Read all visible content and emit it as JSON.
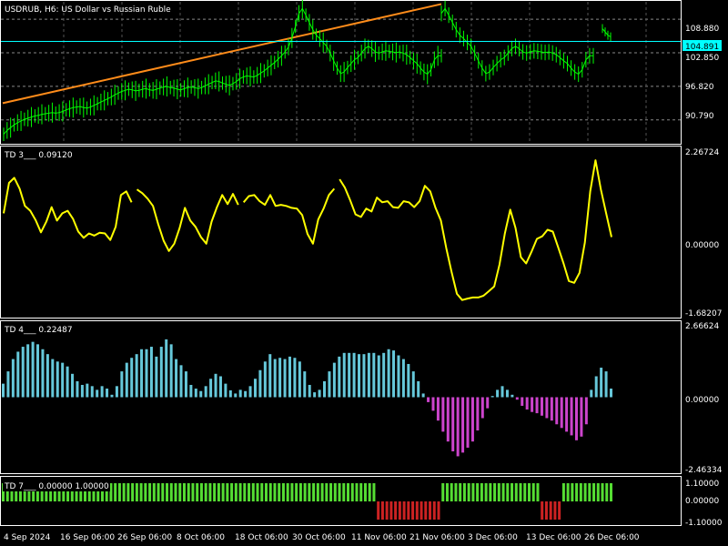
{
  "chart_data": [
    {
      "type": "line",
      "title": "USDRUB, H6:  US Dollar vs Russian Ruble",
      "yticks": [
        "108.880",
        "102.850",
        "96.820",
        "90.790"
      ],
      "ylim": [
        86.5,
        112.0
      ],
      "grid": true,
      "current_price": "104.891",
      "current_price_value": 104.891,
      "colors": {
        "up": "#00ff00",
        "price_line": "#00ffff",
        "trendline": "#ff8c1a",
        "price_box": "#00ffff"
      },
      "series": [
        {
          "values": [
            88.2,
            88.9,
            89.4,
            89.9,
            90.3,
            90.6,
            90.9,
            91.1,
            91.3,
            91.5,
            91.6,
            91.8,
            91.9,
            92.0,
            92.1,
            92.0,
            92.1,
            92.3,
            92.6,
            92.8,
            93.0,
            93.1,
            93.2,
            93.0,
            92.9,
            93.1,
            93.4,
            93.7,
            94.0,
            94.3,
            94.6,
            94.9,
            95.3,
            95.6,
            95.9,
            96.1,
            96.3,
            96.2,
            96.0,
            96.1,
            96.3,
            96.4,
            96.2,
            96.1,
            96.3,
            96.5,
            96.7,
            96.8,
            96.6,
            96.5,
            96.3,
            96.2,
            96.4,
            96.6,
            96.7,
            96.6,
            96.4,
            96.6,
            96.9,
            97.2,
            97.5,
            97.8,
            97.7,
            97.4,
            97.2,
            97.0,
            97.3,
            97.7,
            98.2,
            98.5,
            98.7,
            98.6,
            98.5,
            98.8,
            99.2,
            99.6,
            100.1,
            100.6,
            101.1,
            101.7,
            102.3,
            103.0,
            103.9,
            105.5,
            107.6,
            109.9,
            110.8,
            109.6,
            108.3,
            107.0,
            106.0,
            105.4,
            104.7,
            104.0,
            102.8,
            101.4,
            100.1,
            99.1,
            99.4,
            100.2,
            100.9,
            101.6,
            102.0,
            102.8,
            103.6,
            104.0,
            103.6,
            103.0,
            102.8,
            103.0,
            103.2,
            103.1,
            103.0,
            102.9,
            103.0,
            102.8,
            102.5,
            102.0,
            101.4,
            100.9,
            100.1,
            99.4,
            99.0,
            99.8,
            101.6,
            102.3,
            102.3
          ]
        },
        {
          "values": [
            107.2,
            106.6,
            106.0,
            105.7
          ],
          "segment": "last-gap"
        }
      ]
    },
    {
      "type": "line",
      "title": "TD 3___ 0.09120",
      "yticks": [
        "2.26724",
        "0.00000",
        "-1.68207"
      ],
      "ylim": [
        -2.1,
        2.55
      ],
      "colors": {
        "line": "#ffff00"
      },
      "gaps_after": [
        24,
        44,
        62
      ],
      "series": [
        {
          "values": [
            0.75,
            1.58,
            1.72,
            1.42,
            0.95,
            0.82,
            0.56,
            0.23,
            0.52,
            0.92,
            0.55,
            0.75,
            0.82,
            0.6,
            0.25,
            0.08,
            0.2,
            0.14,
            0.22,
            0.2,
            0.02,
            0.38,
            1.25,
            1.35,
            1.05,
            1.4,
            1.3,
            1.15,
            0.95,
            0.45,
            0.0,
            -0.28,
            -0.08,
            0.35,
            0.9,
            0.55,
            0.38,
            0.1,
            -0.08,
            0.52,
            0.92,
            1.25,
            1.0,
            1.28,
            0.98,
            1.05,
            1.22,
            1.25,
            1.08,
            0.98,
            1.25,
            0.95,
            0.98,
            0.95,
            0.9,
            0.88,
            0.7,
            0.18,
            -0.08,
            0.58,
            0.88,
            1.25,
            1.42,
            1.68,
            1.45,
            1.1,
            0.72,
            0.65,
            0.88,
            0.8,
            1.18,
            1.05,
            1.08,
            0.92,
            0.9,
            1.08,
            1.05,
            0.92,
            1.08,
            1.5,
            1.35,
            0.9,
            0.55,
            -0.2,
            -0.85,
            -1.45,
            -1.62,
            -1.58,
            -1.55,
            -1.55,
            -1.5,
            -1.38,
            -1.25,
            -0.65,
            0.2,
            0.85,
            0.35,
            -0.45,
            -0.62,
            -0.3,
            0.05,
            0.12,
            0.3,
            0.25,
            -0.18,
            -0.62,
            -1.1,
            -1.15,
            -0.88,
            -0.05,
            1.35,
            2.2,
            1.4,
            0.75,
            0.1
          ]
        }
      ]
    },
    {
      "type": "bar",
      "title": "TD 4___ 0.22487",
      "yticks": [
        "2.66624",
        "0.00000",
        "-2.46334"
      ],
      "ylim": [
        -3.05,
        3.05
      ],
      "colors": {
        "positive": "#66c8da",
        "negative": "#cc44cc"
      },
      "series": [
        {
          "values": [
            0.55,
            1.05,
            1.55,
            1.85,
            2.05,
            2.15,
            2.25,
            2.15,
            1.95,
            1.75,
            1.55,
            1.45,
            1.4,
            1.25,
            0.95,
            0.65,
            0.5,
            0.55,
            0.45,
            0.3,
            0.45,
            0.35,
            0.1,
            0.45,
            1.05,
            1.4,
            1.6,
            1.75,
            1.95,
            1.95,
            2.05,
            1.65,
            2.05,
            2.35,
            2.15,
            1.55,
            1.3,
            1.05,
            0.5,
            0.35,
            0.25,
            0.45,
            0.75,
            0.95,
            0.85,
            0.55,
            0.28,
            0.15,
            0.3,
            0.25,
            0.45,
            0.75,
            1.1,
            1.45,
            1.75,
            1.55,
            1.6,
            1.55,
            1.65,
            1.6,
            1.45,
            1.05,
            0.5,
            0.2,
            0.3,
            0.65,
            1.05,
            1.4,
            1.65,
            1.8,
            1.8,
            1.8,
            1.75,
            1.75,
            1.8,
            1.8,
            1.7,
            1.8,
            1.95,
            1.9,
            1.7,
            1.55,
            1.35,
            1.05,
            0.65,
            0.15,
            -0.2,
            -0.55,
            -0.95,
            -1.4,
            -1.8,
            -2.2,
            -2.4,
            -2.25,
            -2.05,
            -1.8,
            -1.35,
            -0.85,
            -0.45,
            0.05,
            0.3,
            0.45,
            0.3,
            0.1,
            -0.1,
            -0.35,
            -0.5,
            -0.6,
            -0.65,
            -0.75,
            -0.85,
            -0.95,
            -1.1,
            -1.25,
            -1.4,
            -1.55,
            -1.75,
            -1.6,
            -1.1,
            0.3,
            0.85,
            1.2,
            1.05,
            0.35
          ]
        }
      ]
    },
    {
      "type": "bar",
      "title": "TD 7___ 0.00000 1.00000",
      "yticks": [
        "1.10000",
        "0.00000",
        "-1.10000"
      ],
      "ylim": [
        -1.3,
        1.3
      ],
      "colors": {
        "positive": "#55dd33",
        "negative": "#cc2222"
      },
      "series": [
        {
          "values": [
            1,
            1,
            1,
            1,
            1,
            1,
            1,
            1,
            1,
            1,
            1,
            1,
            1,
            1,
            1,
            1,
            1,
            1,
            1,
            1,
            1,
            1,
            1,
            1,
            1,
            1,
            1,
            1,
            1,
            1,
            1,
            1,
            1,
            1,
            1,
            1,
            1,
            1,
            1,
            1,
            1,
            1,
            1,
            1,
            1,
            1,
            1,
            1,
            1,
            1,
            1,
            1,
            1,
            1,
            1,
            1,
            1,
            1,
            1,
            1,
            1,
            1,
            1,
            1,
            1,
            1,
            1,
            1,
            1,
            1,
            1,
            1,
            1,
            1,
            1,
            1,
            1,
            1,
            1,
            1,
            1,
            1,
            1,
            1,
            1,
            1,
            1,
            -1,
            -1,
            -1,
            -1,
            -1,
            -1,
            -1,
            -1,
            -1,
            -1,
            -1,
            -1,
            -1,
            -1,
            -1,
            1,
            1,
            1,
            1,
            1,
            1,
            1,
            1,
            1,
            1,
            1,
            1,
            1,
            1,
            1,
            1,
            1,
            1,
            1,
            1,
            1,
            1,
            1,
            -1,
            -1,
            -1,
            -1,
            -1,
            1,
            1,
            1,
            1,
            1,
            1,
            1,
            1,
            1,
            1,
            1,
            1
          ]
        }
      ]
    },
    {
      "type": "x-axis",
      "categories": [
        "4 Sep 2024",
        "16 Sep 06:00",
        "26 Sep 06:00",
        "8 Oct 06:00",
        "18 Oct 06:00",
        "30 Oct 06:00",
        "11 Nov 06:00",
        "21 Nov 06:00",
        "3 Dec 06:00",
        "13 Dec 06:00",
        "26 Dec 06:00"
      ]
    }
  ]
}
